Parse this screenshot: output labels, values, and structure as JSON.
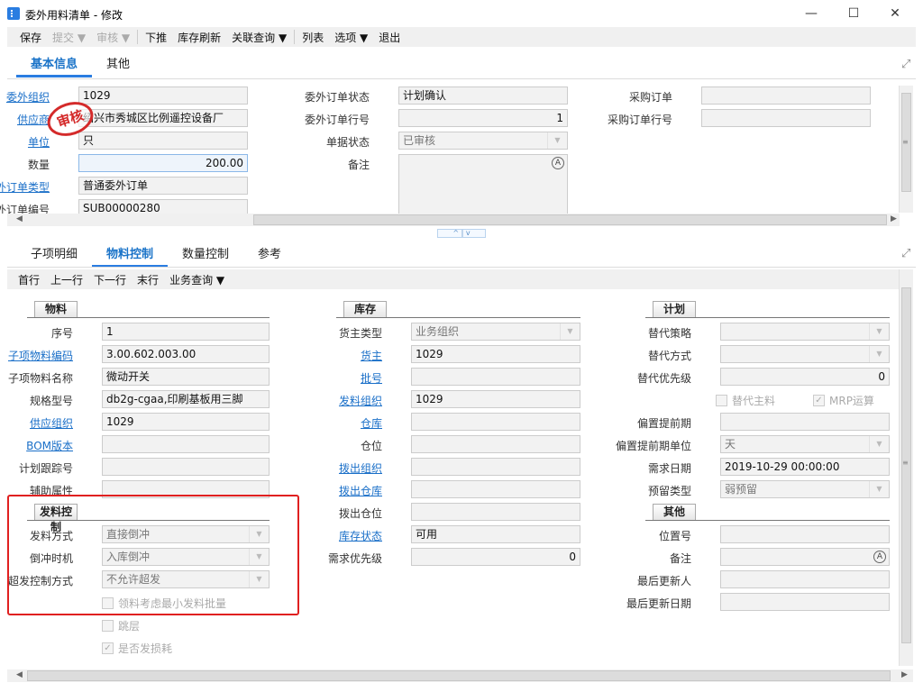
{
  "window": {
    "title": "委外用料清单 - 修改",
    "minimize": "—",
    "maximize": "☐",
    "close": "✕"
  },
  "toolbar": [
    {
      "label": "保存",
      "dis": false
    },
    {
      "label": "提交 ▼",
      "dis": true
    },
    {
      "label": "审核 ▼",
      "dis": true,
      "sep": true
    },
    {
      "label": "下推"
    },
    {
      "label": "库存刷新"
    },
    {
      "label": "关联查询 ▼",
      "sep": true
    },
    {
      "label": "列表"
    },
    {
      "label": "选项 ▼"
    },
    {
      "label": "退出"
    }
  ],
  "top_tabs": [
    {
      "label": "基本信息",
      "active": true
    },
    {
      "label": "其他"
    }
  ],
  "stamp": "审核",
  "header_form": {
    "left": [
      {
        "label": "委外组织",
        "link": true,
        "value": "1029"
      },
      {
        "label": "供应商",
        "link": true,
        "value": "绍兴市秀城区比例遥控设备厂"
      },
      {
        "label": "单位",
        "link": true,
        "value": "只"
      },
      {
        "label": "数量",
        "value": "200.00",
        "num": true,
        "focus": true
      },
      {
        "label": "委外订单类型",
        "link": true,
        "value": "普通委外订单"
      },
      {
        "label": "委外订单编号",
        "value": "SUB00000280"
      }
    ],
    "middle": [
      {
        "label": "委外订单状态",
        "value": "计划确认"
      },
      {
        "label": "委外订单行号",
        "value": "1",
        "num": true
      },
      {
        "label": "单据状态",
        "value": "已审核",
        "select": true
      },
      {
        "label": "备注",
        "value": "",
        "memo": true
      }
    ],
    "right": [
      {
        "label": "采购订单",
        "value": ""
      },
      {
        "label": "采购订单行号",
        "value": ""
      }
    ]
  },
  "splitter": "^ | v",
  "bottom_tabs": [
    {
      "label": "子项明细"
    },
    {
      "label": "物料控制",
      "active": true
    },
    {
      "label": "数量控制"
    },
    {
      "label": "参考"
    }
  ],
  "row_toolbar": [
    "首行",
    "上一行",
    "下一行",
    "末行",
    "业务查询 ▼"
  ],
  "detail": {
    "left": [
      {
        "section": "物料"
      },
      {
        "label": "序号",
        "value": "1"
      },
      {
        "label": "子项物料编码",
        "link": true,
        "value": "3.00.602.003.00"
      },
      {
        "label": "子项物料名称",
        "value": "微动开关"
      },
      {
        "label": "规格型号",
        "value": "db2g-cgaa,印刷基板用三脚"
      },
      {
        "label": "供应组织",
        "link": true,
        "value": "1029"
      },
      {
        "label": "BOM版本",
        "link": true,
        "value": ""
      },
      {
        "label": "计划跟踪号",
        "value": ""
      },
      {
        "label": "辅助属性",
        "value": ""
      },
      {
        "section": "发料控制"
      },
      {
        "label": "发料方式",
        "value": "直接倒冲",
        "select": true
      },
      {
        "label": "倒冲时机",
        "value": "入库倒冲",
        "select": true
      },
      {
        "label": "超发控制方式",
        "value": "不允许超发",
        "select": true
      },
      {
        "check": "领料考虑最小发料批量",
        "checked": false
      },
      {
        "check": "跳层",
        "checked": false
      },
      {
        "check": "是否发损耗",
        "checked": true
      }
    ],
    "middle": [
      {
        "section": "库存"
      },
      {
        "label": "货主类型",
        "value": "业务组织",
        "select": true
      },
      {
        "label": "货主",
        "link": true,
        "value": "1029"
      },
      {
        "label": "批号",
        "link": true,
        "value": ""
      },
      {
        "label": "发料组织",
        "link": true,
        "value": "1029"
      },
      {
        "label": "仓库",
        "link": true,
        "value": ""
      },
      {
        "label": "仓位",
        "value": ""
      },
      {
        "label": "拨出组织",
        "link": true,
        "value": ""
      },
      {
        "label": "拨出仓库",
        "link": true,
        "value": ""
      },
      {
        "label": "拨出仓位",
        "value": ""
      },
      {
        "label": "库存状态",
        "link": true,
        "value": "可用"
      },
      {
        "label": "需求优先级",
        "value": "0",
        "num": true
      }
    ],
    "right": [
      {
        "section": "计划"
      },
      {
        "label": "替代策略",
        "value": "",
        "select": true
      },
      {
        "label": "替代方式",
        "value": "",
        "select": true
      },
      {
        "label": "替代优先级",
        "value": "0",
        "num": true
      },
      {
        "checks": [
          {
            "check": "替代主料",
            "checked": false
          },
          {
            "check": "MRP运算",
            "checked": true
          }
        ]
      },
      {
        "label": "偏置提前期",
        "value": ""
      },
      {
        "label": "偏置提前期单位",
        "value": "天",
        "select": true
      },
      {
        "label": "需求日期",
        "value": "2019-10-29 00:00:00"
      },
      {
        "label": "预留类型",
        "value": "弱预留",
        "select": true
      },
      {
        "section": "其他"
      },
      {
        "label": "位置号",
        "value": ""
      },
      {
        "label": "备注",
        "value": "",
        "memo": true
      },
      {
        "label": "最后更新人",
        "value": ""
      },
      {
        "label": "最后更新日期",
        "value": ""
      }
    ]
  }
}
